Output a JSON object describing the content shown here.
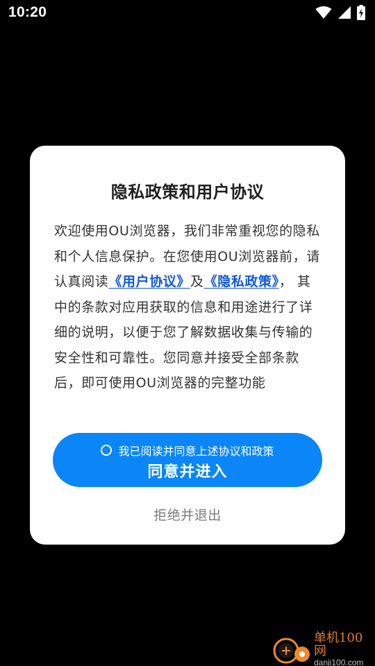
{
  "status_bar": {
    "time": "10:20",
    "icons": [
      "wifi-icon",
      "cell-signal-icon",
      "battery-charging-icon"
    ]
  },
  "dialog": {
    "title": "隐私政策和用户协议",
    "body_intro": "欢迎使用OU浏览器，我们非常重视您的隐私和个人信息保护。在您使用OU浏览器前，请认真阅读",
    "user_agreement_link": "《用户协议》",
    "conjunction": "及",
    "privacy_policy_link": "《隐私政策》",
    "body_rest": "， 其中的条款对应用获取的信息和用途进行了详细的说明，以便于您了解数据收集与传输的安全性和可靠性。您同意并接受全部条款后，即可使用OU浏览器的完整功能",
    "consent_text": "我已阅读并同意上述协议和政策",
    "agree_label": "同意并进入",
    "refuse_label": "拒绝并退出"
  },
  "watermark": {
    "title": "单机100网",
    "url": "danji100.com"
  },
  "colors": {
    "background": "#000000",
    "dialog": "#ffffff",
    "accent": "#0a86f8",
    "link": "#1158d8"
  }
}
